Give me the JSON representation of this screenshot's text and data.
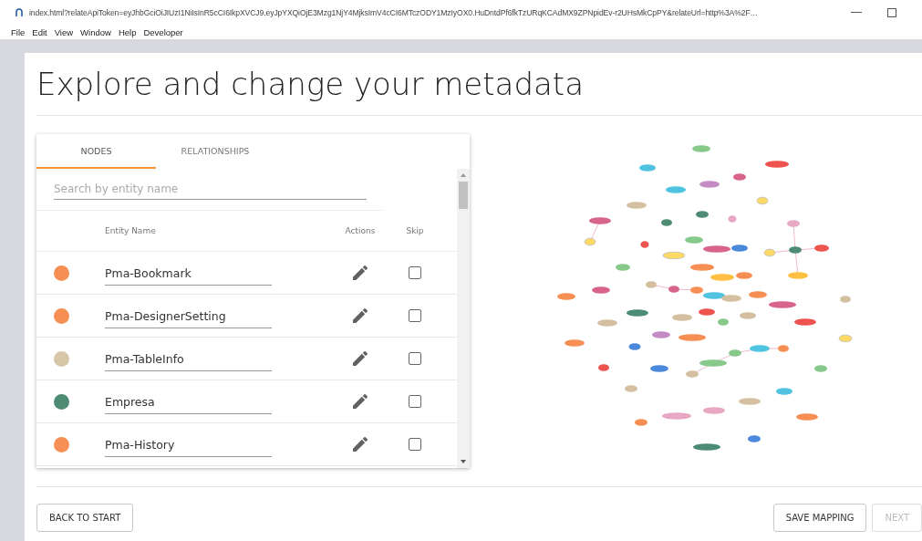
{
  "window": {
    "title": "index.html?relateApiToken=eyJhbGciOiJIUzI1NiIsInR5cCI6IkpXVCJ9.eyJpYXQiOjE3Mzg1NjY4MjksImV4cCI6MTczODY1MzIyOX0.HuDntdPf6fkTzURqKCAdMX9ZPNpidEv-r2UHsMkCpPY&relateUrl=http%3A%2F…"
  },
  "menu": [
    "File",
    "Edit",
    "View",
    "Window",
    "Help",
    "Developer"
  ],
  "page_title": "Explore and change your metadata",
  "tabs": [
    {
      "label": "NODES",
      "selected": true
    },
    {
      "label": "RELATIONSHIPS",
      "selected": false
    }
  ],
  "search": {
    "placeholder": "Search by entity name"
  },
  "table": {
    "columns": [
      "Entity Name",
      "Actions",
      "Skip"
    ],
    "rows": [
      {
        "color": "#f78f55",
        "name": "Pma-Bookmark",
        "checked": false
      },
      {
        "color": "#f78f55",
        "name": "Pma-DesignerSetting",
        "checked": false
      },
      {
        "color": "#d8c6a8",
        "name": "Pma-TableInfo",
        "checked": false
      },
      {
        "color": "#4e8b74",
        "name": "Empresa",
        "checked": false
      },
      {
        "color": "#f78f55",
        "name": "Pma-History",
        "checked": false
      }
    ]
  },
  "buttons": [
    {
      "label": "BACK TO START",
      "disabled": false
    },
    {
      "label": "SAVE MAPPING",
      "disabled": false
    },
    {
      "label": "NEXT",
      "disabled": true
    }
  ]
}
